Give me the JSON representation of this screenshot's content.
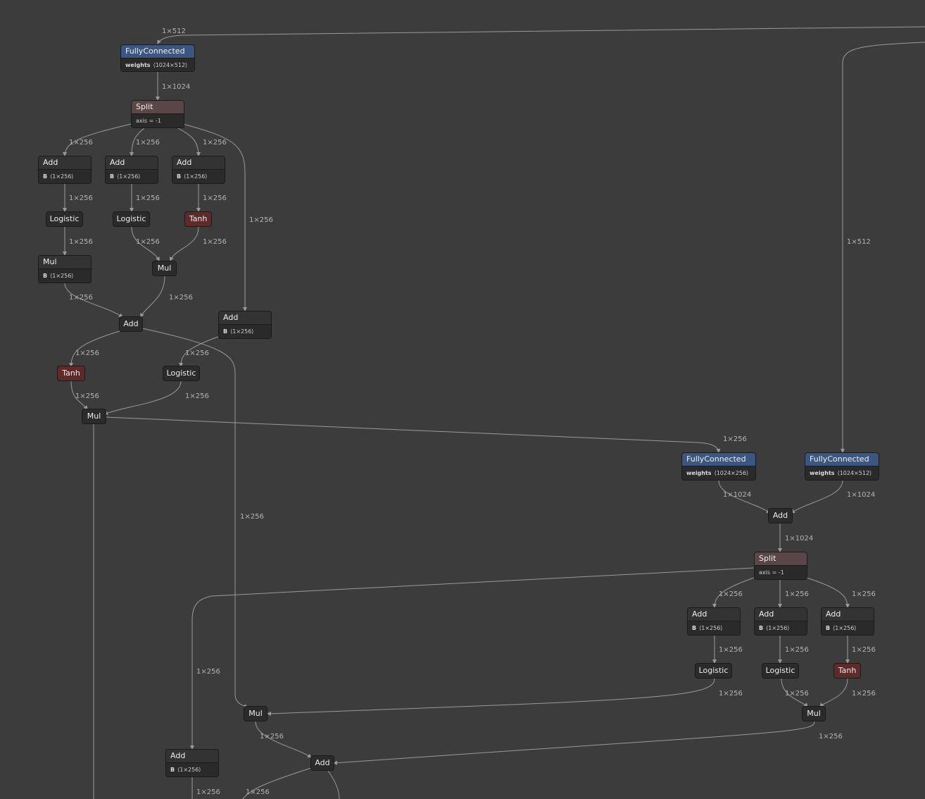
{
  "nodes": {
    "fc1": {
      "title": "FullyConnected",
      "attr_key": "weights",
      "attr_val": "⟨1024×512⟩"
    },
    "split1": {
      "title": "Split",
      "attr_text": "axis = -1"
    },
    "add_a": {
      "title": "Add",
      "attr_key": "B",
      "attr_val": "⟨1×256⟩"
    },
    "add_b": {
      "title": "Add",
      "attr_key": "B",
      "attr_val": "⟨1×256⟩"
    },
    "add_c": {
      "title": "Add",
      "attr_key": "B",
      "attr_val": "⟨1×256⟩"
    },
    "log_a": {
      "title": "Logistic"
    },
    "log_b": {
      "title": "Logistic"
    },
    "tanh_c": {
      "title": "Tanh"
    },
    "mul_a": {
      "title": "Mul",
      "attr_key": "B",
      "attr_val": "⟨1×256⟩"
    },
    "mul_bc": {
      "title": "Mul"
    },
    "add_mid": {
      "title": "Add"
    },
    "add_d": {
      "title": "Add",
      "attr_key": "B",
      "attr_val": "⟨1×256⟩"
    },
    "tanh_e": {
      "title": "Tanh"
    },
    "log_d": {
      "title": "Logistic"
    },
    "mul_out": {
      "title": "Mul"
    },
    "fc2": {
      "title": "FullyConnected",
      "attr_key": "weights",
      "attr_val": "⟨1024×256⟩"
    },
    "fc3": {
      "title": "FullyConnected",
      "attr_key": "weights",
      "attr_val": "⟨1024×512⟩"
    },
    "add_r": {
      "title": "Add"
    },
    "split2": {
      "title": "Split",
      "attr_text": "axis = -1"
    },
    "add_ra": {
      "title": "Add",
      "attr_key": "B",
      "attr_val": "⟨1×256⟩"
    },
    "add_rb": {
      "title": "Add",
      "attr_key": "B",
      "attr_val": "⟨1×256⟩"
    },
    "add_rc": {
      "title": "Add",
      "attr_key": "B",
      "attr_val": "⟨1×256⟩"
    },
    "log_ra": {
      "title": "Logistic"
    },
    "log_rb": {
      "title": "Logistic"
    },
    "tanh_rc": {
      "title": "Tanh"
    },
    "mul_left": {
      "title": "Mul"
    },
    "mul_r": {
      "title": "Mul"
    },
    "add_bottom": {
      "title": "Add"
    },
    "add_bl": {
      "title": "Add",
      "attr_key": "B",
      "attr_val": "⟨1×256⟩"
    }
  },
  "edge_labels": {
    "e01": "1×512",
    "e02": "1×1024",
    "e03": "1×256",
    "e04": "1×256",
    "e05": "1×256",
    "e06": "1×256",
    "e07": "1×256",
    "e08": "1×256",
    "e09": "1×256",
    "e10": "1×256",
    "e11": "1×256",
    "e12": "1×256",
    "e13": "1×256",
    "e14": "1×256",
    "e15": "1×256",
    "e16": "1×256",
    "e17": "1×256",
    "e18": "1×256",
    "e19": "1×512",
    "e20": "1×256",
    "e21": "1×1024",
    "e22": "1×1024",
    "e23": "1×1024",
    "e24": "1×256",
    "e25": "1×256",
    "e26": "1×256",
    "e27": "1×256",
    "e28": "1×256",
    "e29": "1×256",
    "e30": "1×256",
    "e31": "1×256",
    "e32": "1×256",
    "e33": "1×256",
    "e34": "1×256",
    "e35": "1×256",
    "e36": "1×256",
    "e37": "1×256",
    "e38": "1×256"
  }
}
